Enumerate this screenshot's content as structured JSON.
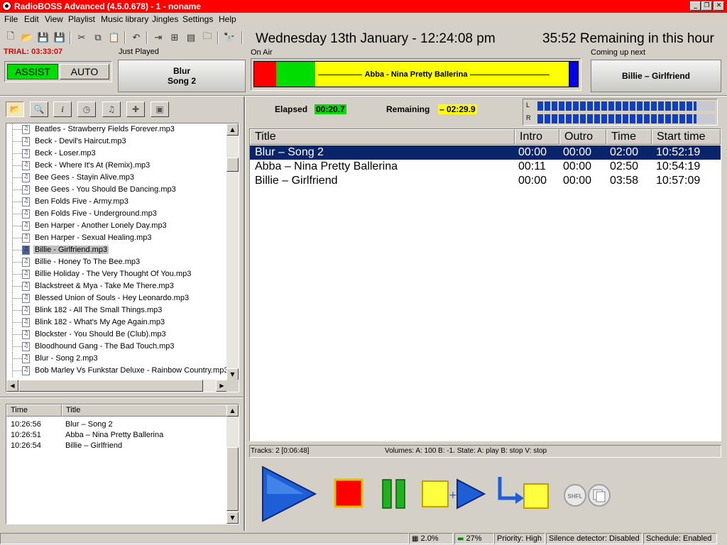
{
  "window": {
    "title": "RadioBOSS Advanced (4.5.0.678) - 1 - noname"
  },
  "menu": [
    "File",
    "Edit",
    "View",
    "Playlist",
    "Music library",
    "Jingles",
    "Settings",
    "Help"
  ],
  "header": {
    "clock": "Wednesday 13th January - 12:24:08 pm",
    "remaining_hour": "35:52 Remaining in this hour",
    "trial": "TRIAL: 03:33:07",
    "just_played_label": "Just Played",
    "on_air_label": "On Air",
    "coming_up_label": "Coming up next",
    "assist_label": "ASSIST",
    "auto_label": "AUTO",
    "just_played_line1": "Blur",
    "just_played_line2": "Song 2",
    "on_air_title": "Abba - Nina Pretty Ballerina",
    "coming_up_title": "Billie – Girlfriend"
  },
  "tree": {
    "items": [
      "Beatles - Strawberry Fields Forever.mp3",
      "Beck - Devil's Haircut.mp3",
      "Beck - Loser.mp3",
      "Beck - Where It's At (Remix).mp3",
      "Bee Gees - Stayin Alive.mp3",
      "Bee Gees - You Should Be Dancing.mp3",
      "Ben Folds Five - Army.mp3",
      "Ben Folds Five - Underground.mp3",
      "Ben Harper - Another Lonely Day.mp3",
      "Ben Harper - Sexual Healing.mp3",
      "Billie - Girlfriend.mp3",
      "Billie - Honey To The Bee.mp3",
      "Billie Holiday - The Very Thought Of You.mp3",
      "Blackstreet & Mya - Take Me There.mp3",
      "Blessed Union of Souls - Hey Leonardo.mp3",
      "Blink 182 - All The Small Things.mp3",
      "Blink 182 - What's My Age Again.mp3",
      "Blockster - You Should Be (Club).mp3",
      "Bloodhound Gang - The Bad Touch.mp3",
      "Blur - Song 2.mp3",
      "Bob Marley Vs Funkstar Deluxe - Rainbow Country.mp3"
    ],
    "selected_index": 10
  },
  "history": {
    "columns": [
      "Time",
      "Title"
    ],
    "rows": [
      {
        "time": "10:26:56",
        "title": "Blur – Song 2"
      },
      {
        "time": "10:26:51",
        "title": "Abba – Nina Pretty Ballerina"
      },
      {
        "time": "10:26:54",
        "title": "Billie – Girlfriend"
      }
    ]
  },
  "player": {
    "elapsed_label": "Elapsed",
    "elapsed_value": "00:20.7",
    "remaining_label": "Remaining",
    "remaining_value": "– 02:29.9",
    "meter_left_label": "L",
    "meter_right_label": "R"
  },
  "playlist": {
    "columns": [
      "Title",
      "Intro",
      "Outro",
      "Time",
      "Start time"
    ],
    "rows": [
      {
        "title": "Blur – Song 2",
        "intro": "00:00",
        "outro": "00:00",
        "time": "02:00",
        "start": "10:52:19"
      },
      {
        "title": "Abba – Nina Pretty Ballerina",
        "intro": "00:11",
        "outro": "00:00",
        "time": "02:50",
        "start": "10:54:19"
      },
      {
        "title": "Billie – Girlfriend",
        "intro": "00:00",
        "outro": "00:00",
        "time": "03:58",
        "start": "10:57:09"
      }
    ],
    "selected_index": 0,
    "tracks_status": "Tracks: 2 [0:06:48]",
    "volume_status": "Volumes: A: 100 B: -1. State: A: play B: stop V: stop"
  },
  "transport": {
    "shuffle_label": "SHFL"
  },
  "statusbar": {
    "cpu": "2.0%",
    "memory": "27%",
    "priority": "Priority: High",
    "silence": "Silence detector: Disabled",
    "schedule": "Schedule: Enabled"
  },
  "colors": {
    "titlebar": "#ff0000",
    "onair_yellow": "#ffff00",
    "onair_red": "#ff0000",
    "onair_green": "#00dd00",
    "selection": "#0a246a",
    "meter_blue": "#1040c0"
  }
}
